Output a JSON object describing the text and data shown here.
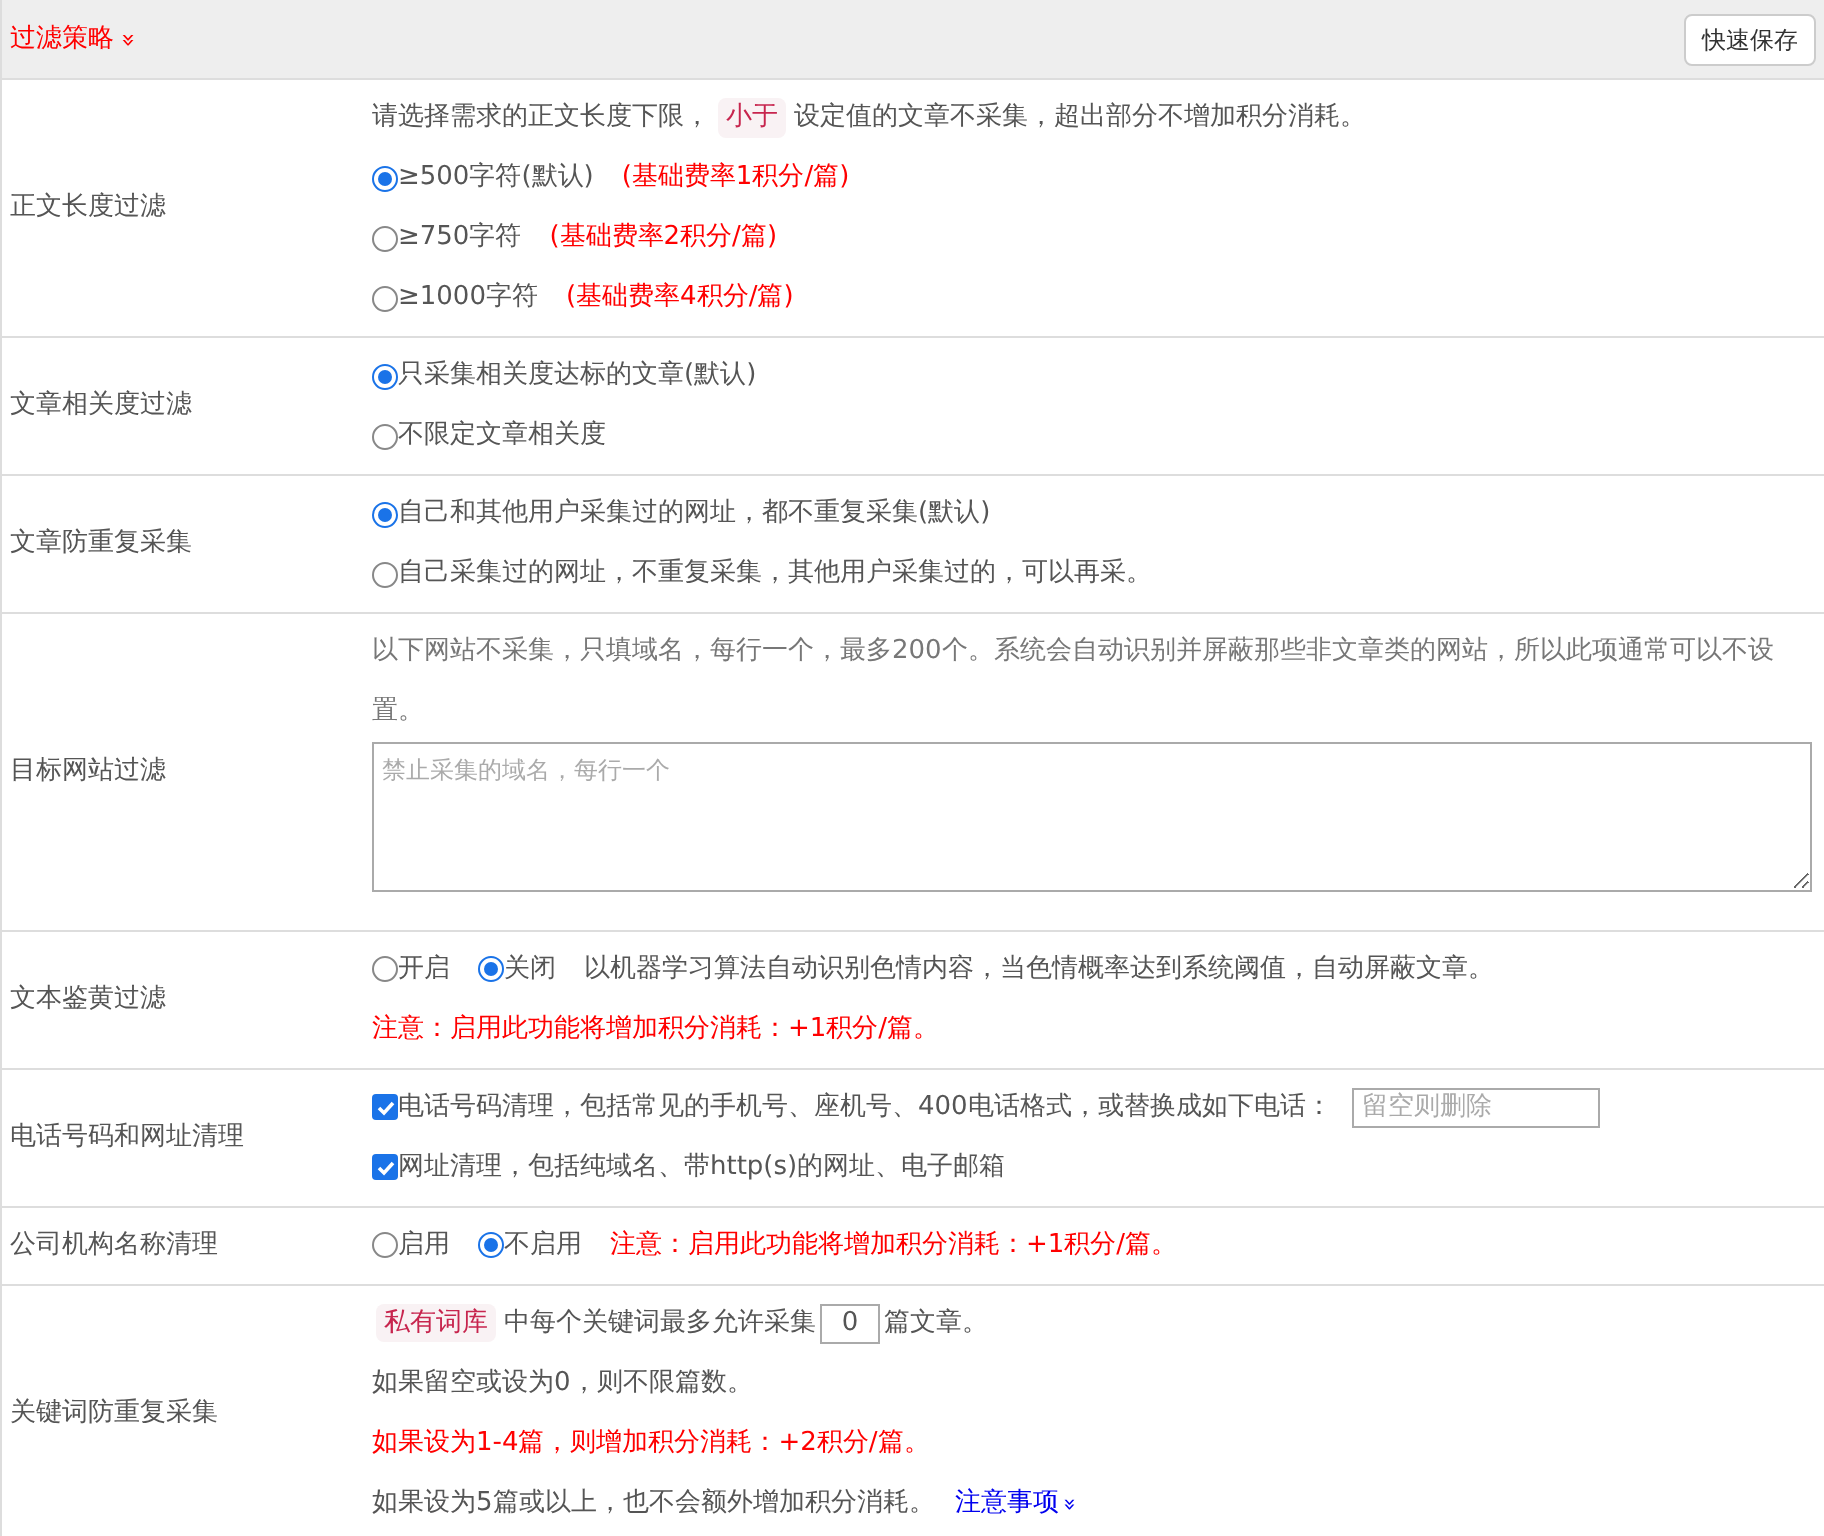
{
  "header": {
    "title": "过滤策略",
    "toggle": "»",
    "save_button": "快速保存"
  },
  "rows": [
    {
      "label": "正文长度过滤",
      "lines": [
        [
          {
            "kind": "text",
            "text": "请选择需求的正文长度下限，"
          },
          {
            "kind": "tag",
            "text": "小于"
          },
          {
            "kind": "text",
            "text": "设定值的文章不采集，超出部分不增加积分消耗。"
          }
        ],
        [
          {
            "kind": "radio",
            "label": "≥500字符(默认)",
            "selected": true
          },
          {
            "kind": "note",
            "text": "(基础费率1积分/篇)"
          }
        ],
        [
          {
            "kind": "radio",
            "label": "≥750字符",
            "selected": false
          },
          {
            "kind": "note",
            "text": "(基础费率2积分/篇)"
          }
        ],
        [
          {
            "kind": "radio",
            "label": "≥1000字符",
            "selected": false
          },
          {
            "kind": "note",
            "text": "(基础费率4积分/篇)"
          }
        ]
      ]
    },
    {
      "label": "文章相关度过滤",
      "lines": [
        [
          {
            "kind": "radio",
            "label": "只采集相关度达标的文章(默认)",
            "selected": true
          }
        ],
        [
          {
            "kind": "radio",
            "label": "不限定文章相关度",
            "selected": false
          }
        ]
      ]
    },
    {
      "label": "文章防重复采集",
      "lines": [
        [
          {
            "kind": "radio",
            "label": "自己和其他用户采集过的网址，都不重复采集(默认)",
            "selected": true
          }
        ],
        [
          {
            "kind": "radio",
            "label": "自己采集过的网址，不重复采集，其他用户采集过的，可以再采。",
            "selected": false
          }
        ]
      ]
    },
    {
      "label": "目标网站过滤",
      "lines": [
        [
          {
            "kind": "muted",
            "text": "以下网站不采集，只填域名，每行一个，最多200个。系统会自动识别并屏蔽那些非文章类的网站，所以此项通常可以不设置。"
          }
        ],
        [
          {
            "kind": "textarea",
            "placeholder": "禁止采集的域名，每行一个"
          }
        ]
      ]
    },
    {
      "label": "文本鉴黄过滤",
      "lines": [
        [
          {
            "kind": "radio",
            "label": "开启",
            "selected": false
          },
          {
            "kind": "radio",
            "label": "关闭",
            "selected": true
          },
          {
            "kind": "text",
            "text": "以机器学习算法自动识别色情内容，当色情概率达到系统阈值，自动屏蔽文章。"
          }
        ],
        [
          {
            "kind": "note",
            "text": "注意：启用此功能将增加积分消耗：+1积分/篇。"
          }
        ]
      ]
    },
    {
      "label": "电话号码和网址清理",
      "lines": [
        [
          {
            "kind": "checkbox",
            "label": "电话号码清理，包括常见的手机号、座机号、400电话格式，或替换成如下电话：",
            "checked": true
          },
          {
            "kind": "input",
            "placeholder": "留空则删除"
          }
        ],
        [
          {
            "kind": "checkbox",
            "label": "网址清理，包括纯域名、带http(s)的网址、电子邮箱",
            "checked": true
          }
        ]
      ]
    },
    {
      "label": "公司机构名称清理",
      "lines": [
        [
          {
            "kind": "radio",
            "label": "启用",
            "selected": false
          },
          {
            "kind": "radio",
            "label": "不启用",
            "selected": true
          },
          {
            "kind": "note",
            "text": "注意：启用此功能将增加积分消耗：+1积分/篇。"
          }
        ]
      ]
    },
    {
      "label": "关键词防重复采集",
      "lines": [
        [
          {
            "kind": "tag",
            "text": "私有词库"
          },
          {
            "kind": "text",
            "text": "中每个关键词最多允许采集"
          },
          {
            "kind": "number",
            "value": "0"
          },
          {
            "kind": "text",
            "text": "篇文章。"
          }
        ],
        [
          {
            "kind": "text",
            "text": "如果留空或设为0，则不限篇数。"
          }
        ],
        [
          {
            "kind": "note",
            "text": "如果设为1-4篇，则增加积分消耗：+2积分/篇。"
          }
        ],
        [
          {
            "kind": "text",
            "text": "如果设为5篇或以上，也不会额外增加积分消耗。"
          },
          {
            "kind": "link",
            "text": "注意事项",
            "caret": "»"
          }
        ]
      ]
    }
  ]
}
